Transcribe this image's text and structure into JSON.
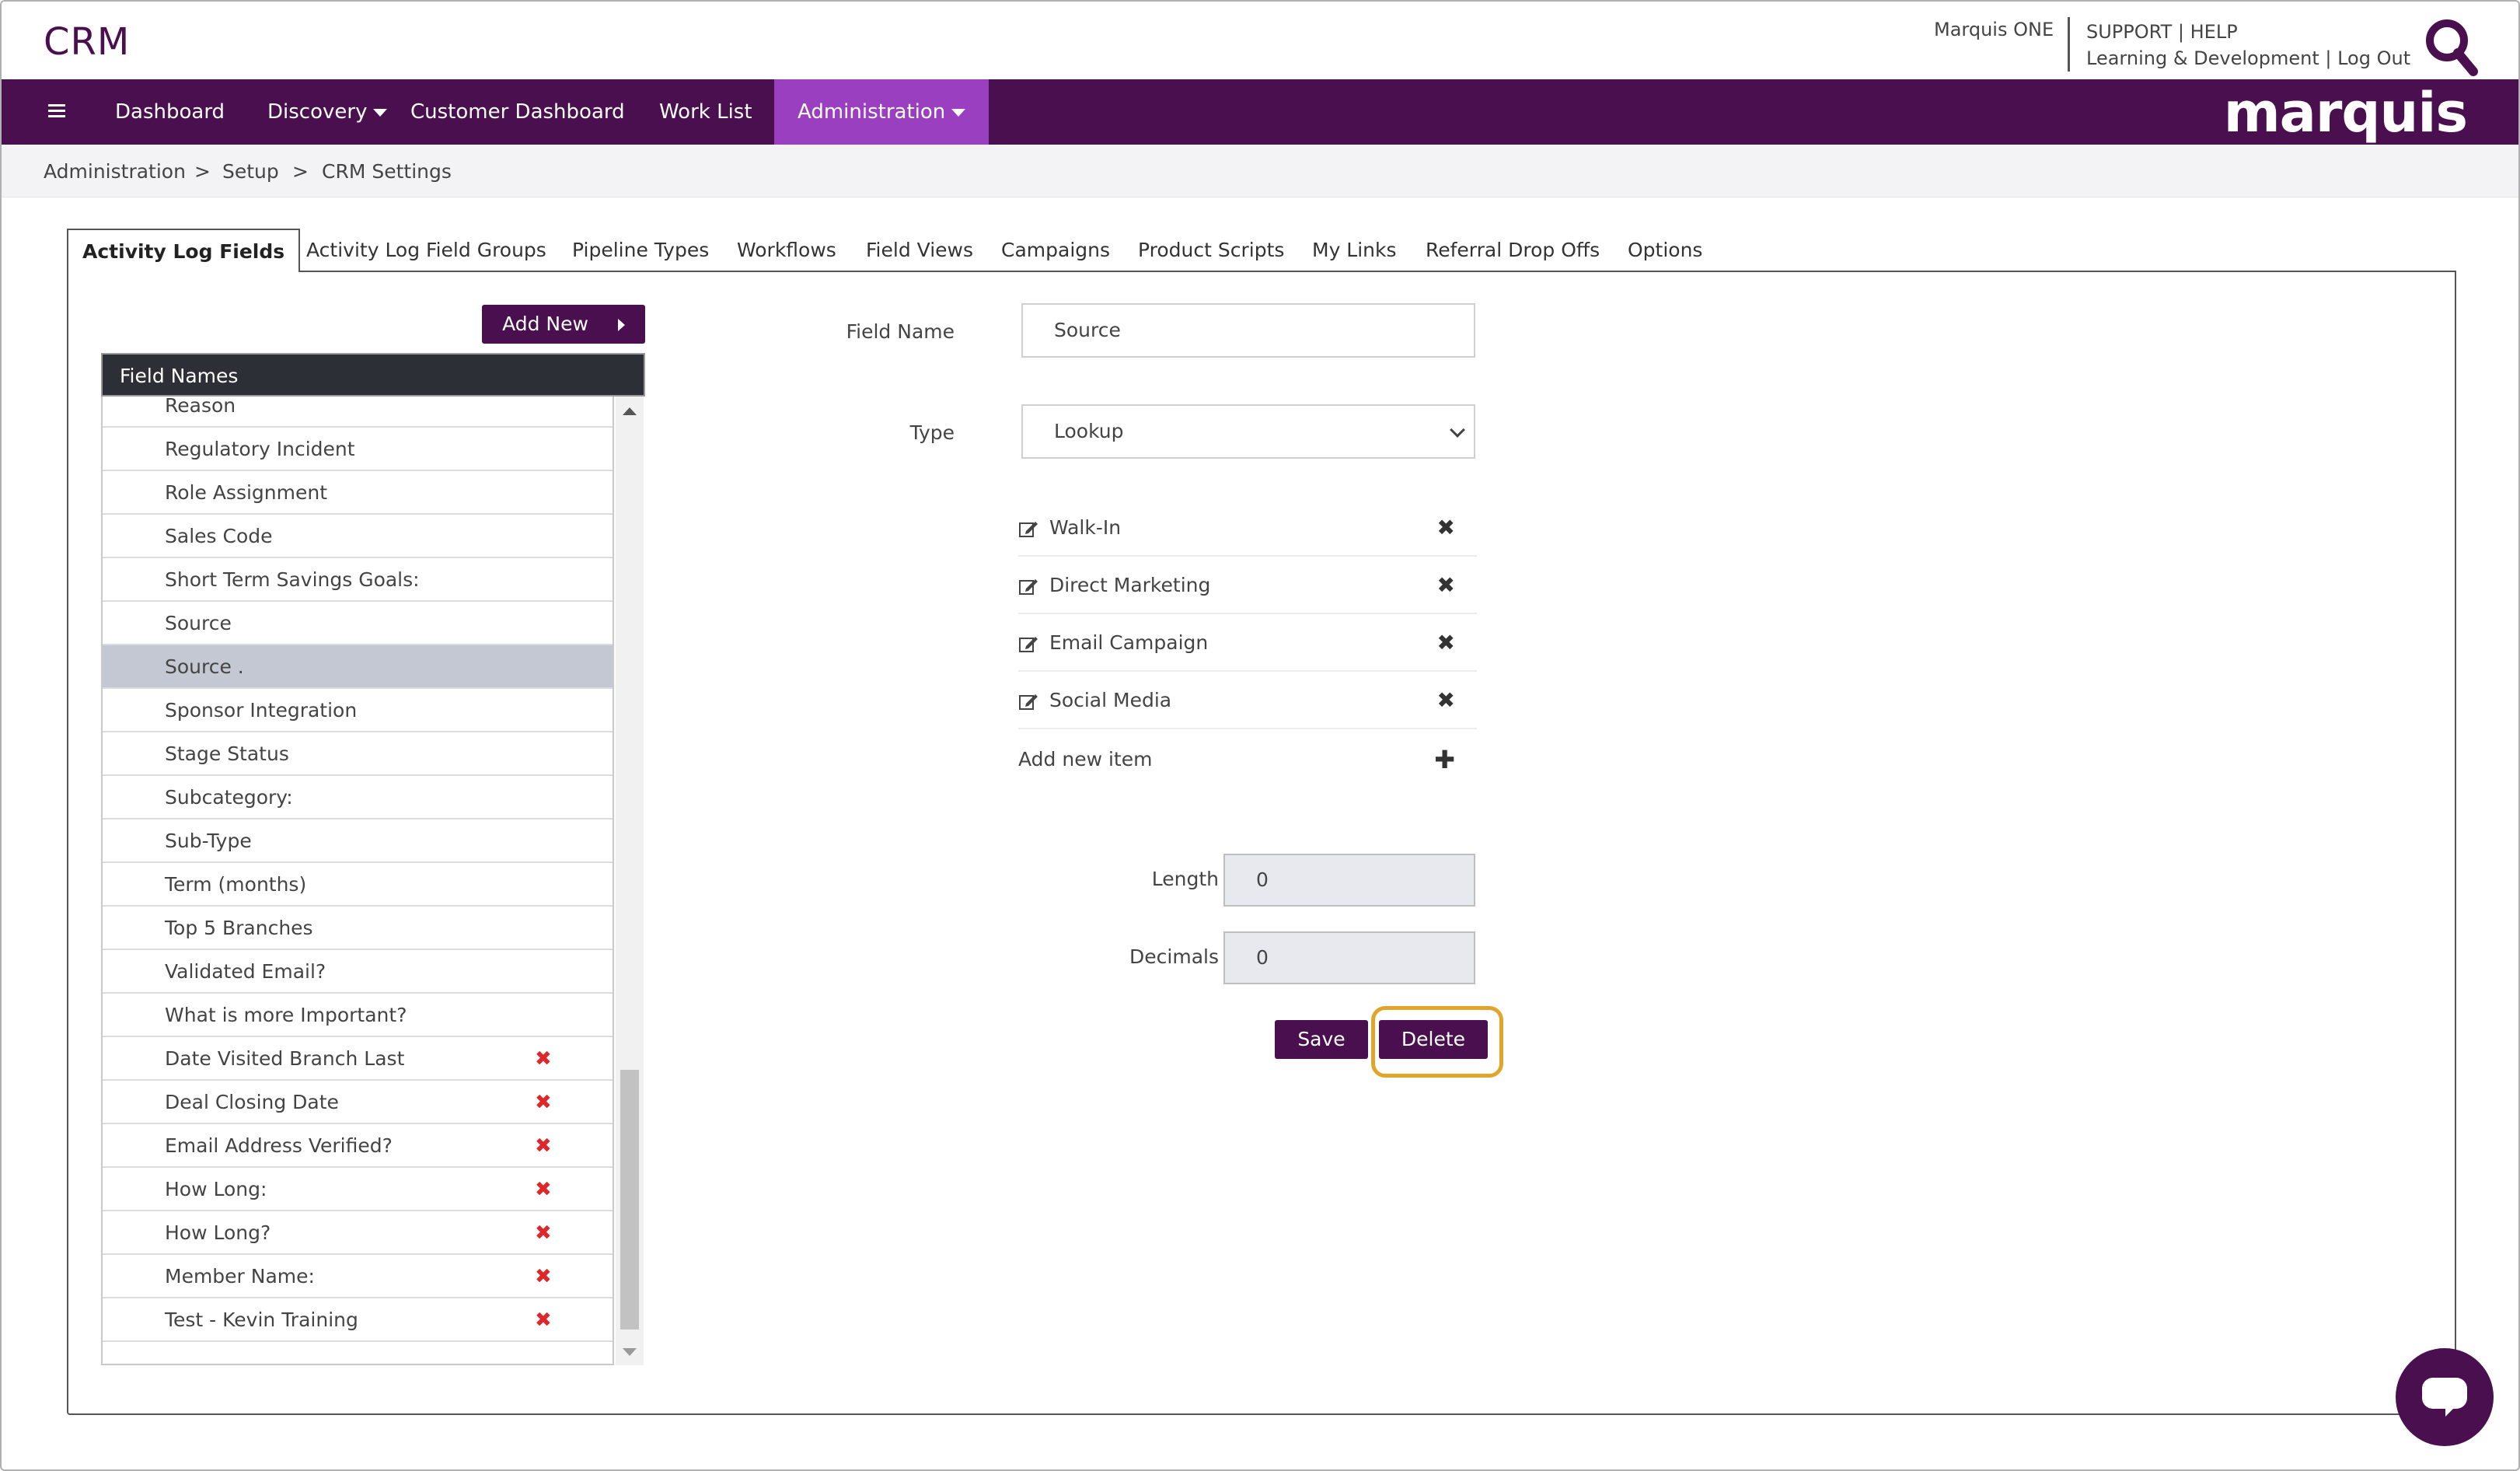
{
  "header": {
    "app_title": "CRM",
    "product_name": "Marquis ONE",
    "links": {
      "support": "SUPPORT",
      "sep1": "|",
      "help": "HELP",
      "learning": "Learning & Development",
      "sep2": "|",
      "logout": "Log Out"
    }
  },
  "nav": {
    "items": [
      {
        "label": "Dashboard"
      },
      {
        "label": "Discovery"
      },
      {
        "label": "Customer Dashboard"
      },
      {
        "label": "Work List"
      },
      {
        "label": "Administration"
      }
    ],
    "brand": "marquis",
    "active_color": "#9a3fc0",
    "bar_color": "#4a0f4f"
  },
  "breadcrumb": {
    "items": [
      "Administration",
      "Setup",
      "CRM Settings"
    ],
    "separator": ">"
  },
  "tabs": [
    {
      "label": "Activity Log Fields"
    },
    {
      "label": "Activity Log Field Groups"
    },
    {
      "label": "Pipeline Types"
    },
    {
      "label": "Workflows"
    },
    {
      "label": "Field Views"
    },
    {
      "label": "Campaigns"
    },
    {
      "label": "Product Scripts"
    },
    {
      "label": "My Links"
    },
    {
      "label": "Referral Drop Offs"
    },
    {
      "label": "Options"
    }
  ],
  "field_list": {
    "add_new_label": "Add New",
    "header": "Field Names",
    "rows": [
      {
        "label": "Reason"
      },
      {
        "label": "Regulatory Incident"
      },
      {
        "label": "Role Assignment"
      },
      {
        "label": "Sales Code"
      },
      {
        "label": "Short Term Savings Goals:"
      },
      {
        "label": "Source"
      },
      {
        "label": "Source ."
      },
      {
        "label": "Sponsor Integration"
      },
      {
        "label": "Stage Status"
      },
      {
        "label": "Subcategory:"
      },
      {
        "label": "Sub-Type"
      },
      {
        "label": "Term (months)"
      },
      {
        "label": "Top 5 Branches"
      },
      {
        "label": "Validated Email?"
      },
      {
        "label": "What is more Important?"
      },
      {
        "label": "Date Visited Branch Last"
      },
      {
        "label": "Deal Closing Date"
      },
      {
        "label": "Email Address Verified?"
      },
      {
        "label": "How Long:"
      },
      {
        "label": "How Long?"
      },
      {
        "label": "Member Name:"
      },
      {
        "label": "Test - Kevin Training"
      }
    ],
    "delete_glyph": "✖"
  },
  "form": {
    "field_name_label": "Field Name",
    "field_name_value": "Source",
    "type_label": "Type",
    "type_value": "Lookup",
    "lookup_items": [
      {
        "label": "Walk-In"
      },
      {
        "label": "Direct Marketing"
      },
      {
        "label": "Email Campaign"
      },
      {
        "label": "Social Media"
      }
    ],
    "add_item_label": "Add new item",
    "remove_glyph": "✖",
    "add_glyph": "✚",
    "length_label": "Length",
    "length_value": "0",
    "decimals_label": "Decimals",
    "decimals_value": "0",
    "save_label": "Save",
    "delete_label": "Delete"
  }
}
